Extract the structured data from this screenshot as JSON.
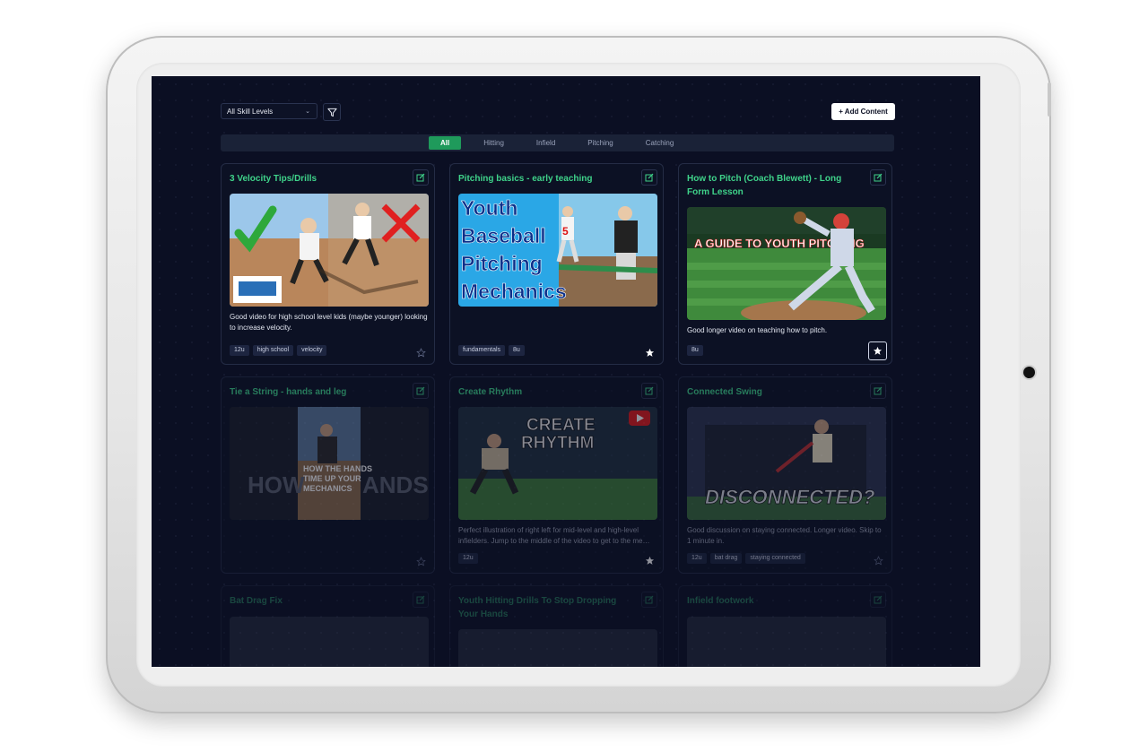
{
  "toolbar": {
    "skill_select": "All Skill Levels",
    "add_button": "+ Add Content"
  },
  "tabs": [
    "All",
    "Hitting",
    "Infield",
    "Pitching",
    "Catching"
  ],
  "active_tab": "All",
  "cards": [
    {
      "title": "3 Velocity Tips/Drills",
      "description": "Good video for high school level kids (maybe younger) looking to increase velocity.",
      "tags": [
        "12u",
        "high school",
        "velocity"
      ],
      "starred": false
    },
    {
      "title": "Pitching basics - early teaching",
      "thumb_text": [
        "Youth",
        "Baseball",
        "Pitching",
        "Mechanics"
      ],
      "description": "",
      "tags": [
        "fundamentals",
        "8u"
      ],
      "starred": true
    },
    {
      "title": "How to Pitch (Coach Blewett) - Long Form Lesson",
      "thumb_text": [
        "A GUIDE TO YOUTH PITCHING"
      ],
      "description": "Good longer video on teaching how to pitch.",
      "tags": [
        "8u"
      ],
      "starred": true
    },
    {
      "title": "Tie a String - hands and leg",
      "thumb_text": [
        "HOW THE HANDS",
        "TIME UP YOUR",
        "MECHANICS"
      ],
      "description": "",
      "tags": [],
      "starred": false
    },
    {
      "title": "Create Rhythm",
      "thumb_text": [
        "CREATE",
        "RHYTHM"
      ],
      "description": "Perfect illustration of right left for mid-level and high-level infielders. Jump to the middle of the video to get to the me…",
      "tags": [
        "12u"
      ],
      "starred": true
    },
    {
      "title": "Connected Swing",
      "thumb_text": [
        "DISCONNECTED?"
      ],
      "description": "Good discussion on staying connected. Longer video. Skip to 1 minute in.",
      "tags": [
        "12u",
        "bat drag",
        "staying connected"
      ],
      "starred": false
    },
    {
      "title": "Bat Drag Fix"
    },
    {
      "title": "Youth Hitting Drills To Stop Dropping Your Hands"
    },
    {
      "title": "Infield footwork"
    }
  ]
}
